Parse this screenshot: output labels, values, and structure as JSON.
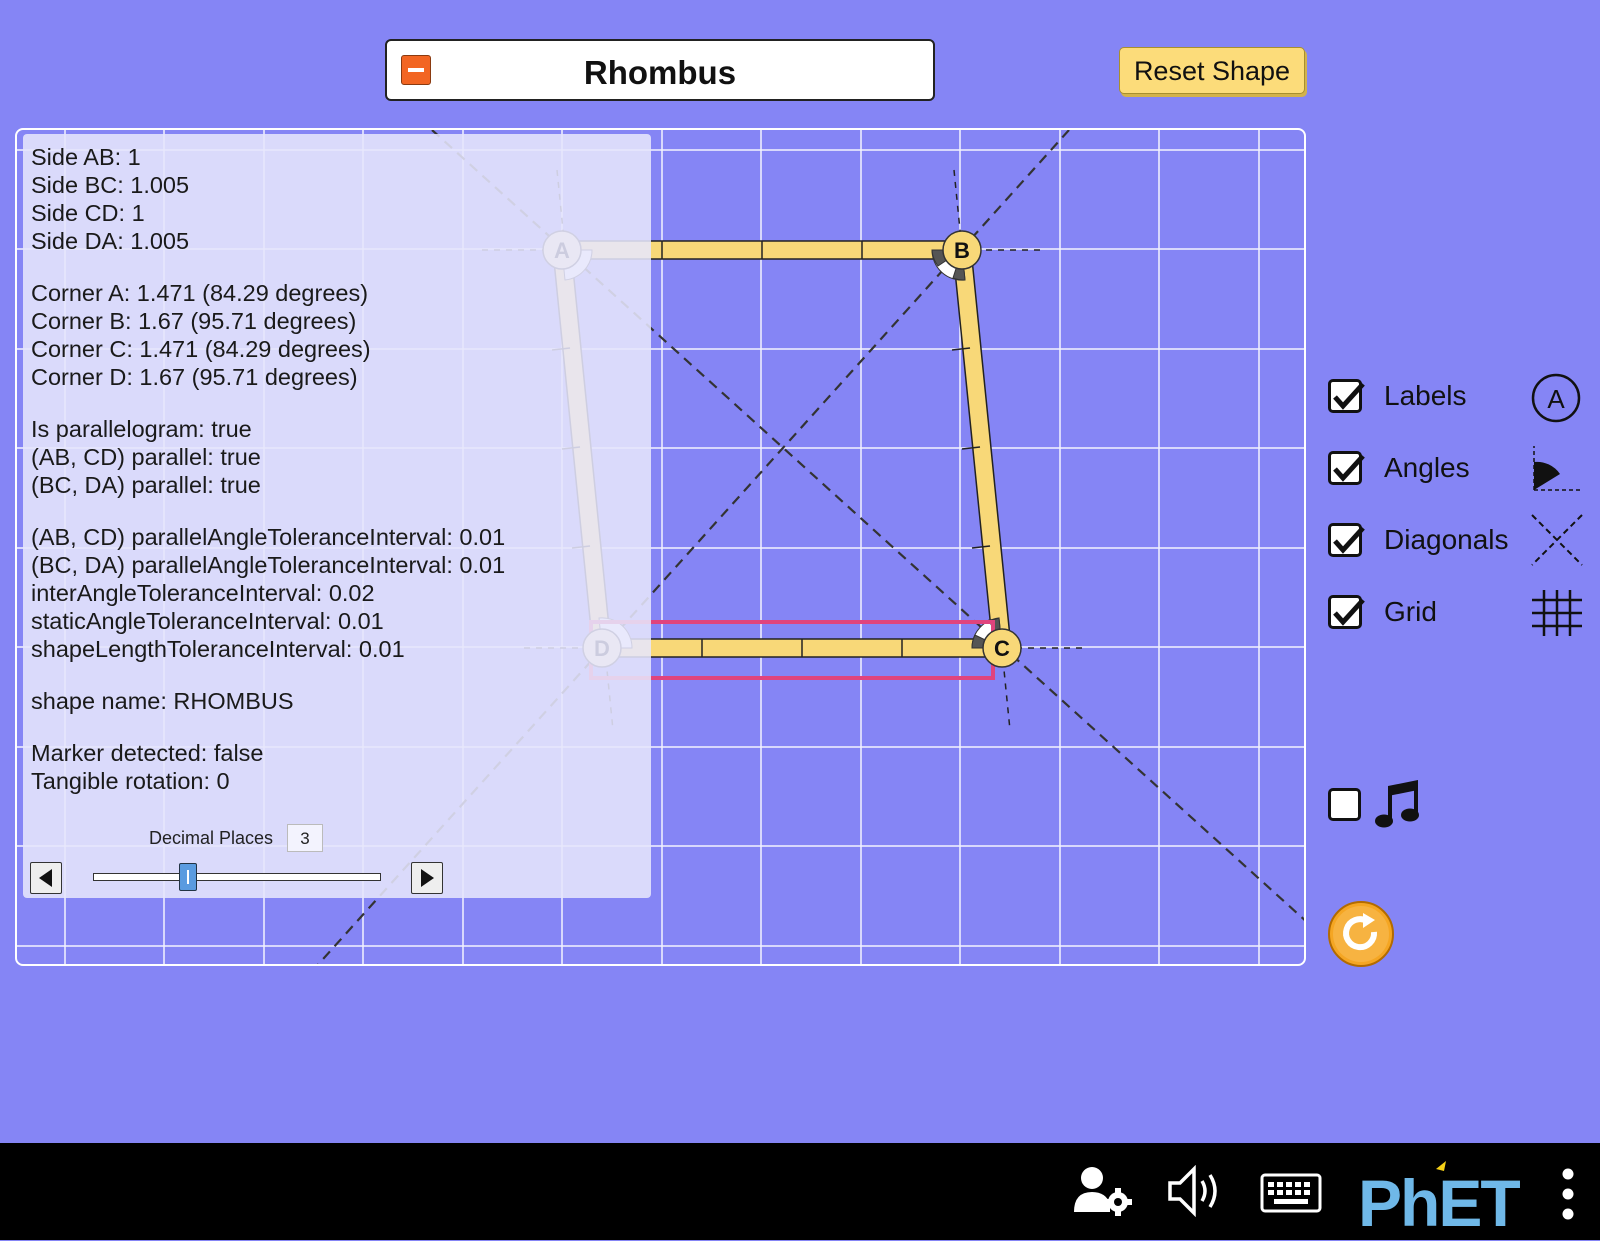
{
  "header": {
    "title": "Rhombus",
    "reset_label": "Reset Shape"
  },
  "shape": {
    "vertices": {
      "A": {
        "label": "A"
      },
      "B": {
        "label": "B"
      },
      "C": {
        "label": "C"
      },
      "D": {
        "label": "D"
      }
    }
  },
  "info": {
    "sides": [
      "Side AB: 1",
      "Side BC: 1.005",
      "Side CD: 1",
      "Side DA: 1.005"
    ],
    "corners": [
      "Corner A: 1.471 (84.29 degrees)",
      "Corner B: 1.67 (95.71 degrees)",
      "Corner C: 1.471 (84.29 degrees)",
      "Corner D: 1.67 (95.71 degrees)"
    ],
    "parallel": [
      "Is parallelogram: true",
      "(AB, CD) parallel: true",
      "(BC, DA) parallel: true"
    ],
    "tolerances": [
      "(AB, CD) parallelAngleToleranceInterval: 0.01",
      "(BC, DA) parallelAngleToleranceInterval: 0.01",
      "interAngleToleranceInterval: 0.02",
      "staticAngleToleranceInterval: 0.01",
      "shapeLengthToleranceInterval: 0.01"
    ],
    "shape_name": "shape name: RHOMBUS",
    "marker": [
      "Marker detected: false",
      "Tangible rotation: 0"
    ],
    "decimal_places_label": "Decimal Places",
    "decimal_places_value": "3",
    "decimal_places_slider": {
      "value": 3,
      "min": 0,
      "max": 10
    }
  },
  "controls": {
    "checkboxes": [
      {
        "label": "Labels",
        "checked": true,
        "icon": "label-a-icon"
      },
      {
        "label": "Angles",
        "checked": true,
        "icon": "angle-icon"
      },
      {
        "label": "Diagonals",
        "checked": true,
        "icon": "diagonals-icon"
      },
      {
        "label": "Grid",
        "checked": true,
        "icon": "grid-icon"
      }
    ],
    "sound_checked": false,
    "sound_icon": "music-note-icon",
    "reset_all_icon": "reset-all-icon",
    "icon_label_a": "A"
  },
  "navbar": {
    "brand": "PhET",
    "icons": [
      "user-settings-icon",
      "sound-on-icon",
      "keyboard-icon",
      "phet-logo",
      "more-menu-icon"
    ]
  },
  "colors": {
    "background": "#8585f5",
    "side_fill": "#f8d878",
    "highlight": "#e0447d",
    "reset_all": "#f5a623"
  }
}
